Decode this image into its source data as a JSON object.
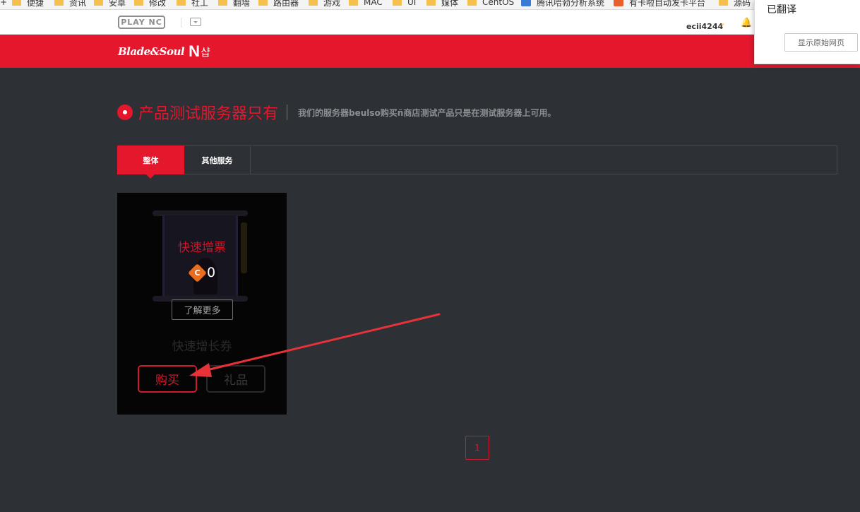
{
  "bookmarks": [
    {
      "label": "便捷",
      "icon": "folder-icon"
    },
    {
      "label": "资讯",
      "icon": "folder-icon"
    },
    {
      "label": "安卓",
      "icon": "folder-icon"
    },
    {
      "label": "修改",
      "icon": "folder-icon"
    },
    {
      "label": "社工",
      "icon": "folder-icon"
    },
    {
      "label": "翻墙",
      "icon": "folder-icon"
    },
    {
      "label": "路由器",
      "icon": "folder-icon"
    },
    {
      "label": "游戏",
      "icon": "folder-icon"
    },
    {
      "label": "MAC",
      "icon": "folder-icon"
    },
    {
      "label": "UI",
      "icon": "folder-icon"
    },
    {
      "label": "媒体",
      "icon": "folder-icon"
    },
    {
      "label": "CentOS",
      "icon": "folder-icon"
    },
    {
      "label": "腾讯哈勃分析系统",
      "icon": "favicon-icon"
    },
    {
      "label": "有卡啦自动发卡平台",
      "icon": "favicon-icon"
    },
    {
      "label": "源码",
      "icon": "folder-icon"
    }
  ],
  "topbar": {
    "plaync_label": "PLAY NC",
    "username": "ecii4244",
    "caret": "⌄",
    "bell": "🔔"
  },
  "header": {
    "logo_script": "Blade&Soul",
    "logo_n": "N",
    "logo_shop": "샵"
  },
  "translate_popup": {
    "title": "已翻译",
    "show_original_label": "显示原始网页"
  },
  "page": {
    "title": "产品测试服务器只有",
    "description": "我们的服务器beulso购买ñ商店测试产品只是在测试服务器上可用。"
  },
  "tabs": [
    {
      "label": "整体",
      "active": true
    },
    {
      "label": "其他服务",
      "active": false
    }
  ],
  "product": {
    "name": "快速增票",
    "coin_symbol": "C",
    "price": "0",
    "more_label": "了解更多",
    "subtitle": "快速增长券",
    "buy_label": "购买",
    "gift_label": "礼品"
  },
  "pagination": {
    "current": "1"
  },
  "colors": {
    "brand_red": "#e4172d",
    "page_bg": "#2d3035",
    "card_bg": "#050505",
    "coin_orange": "#e86d1f",
    "arrow_red": "#e8323a"
  }
}
